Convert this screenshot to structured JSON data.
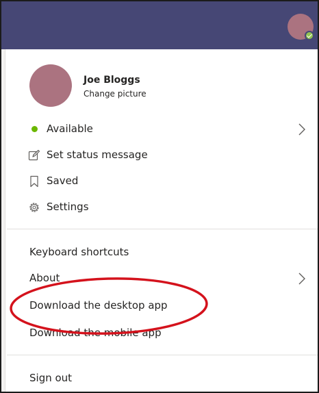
{
  "profile": {
    "name": "Joe Bloggs",
    "change_picture": "Change picture"
  },
  "status_items": [
    {
      "label": "Available",
      "icon": "available-dot-icon"
    },
    {
      "label": "Set status message",
      "icon": "edit-status-icon"
    },
    {
      "label": "Saved",
      "icon": "bookmark-icon"
    },
    {
      "label": "Settings",
      "icon": "gear-icon"
    }
  ],
  "help_items": [
    {
      "label": "Keyboard shortcuts"
    },
    {
      "label": "About"
    },
    {
      "label": "Download the desktop app"
    },
    {
      "label": "Download the mobile app"
    }
  ],
  "footer": {
    "sign_out": "Sign out"
  },
  "colors": {
    "titlebar": "#464775",
    "avatar": "#ab7380",
    "available": "#6bb700",
    "annotation": "#d4121c"
  }
}
